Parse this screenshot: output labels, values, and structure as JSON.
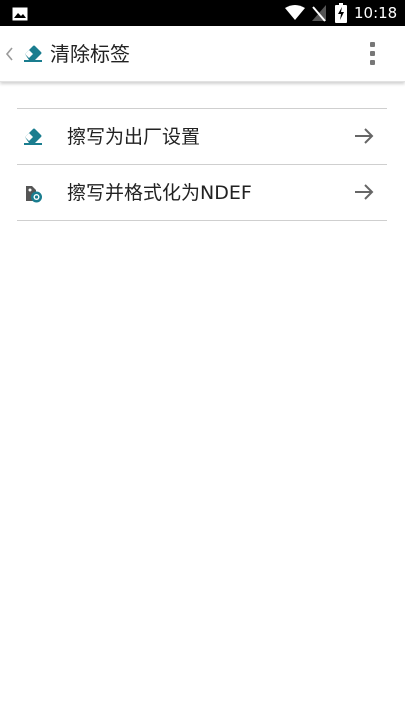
{
  "status_bar": {
    "time": "10:18",
    "icons": [
      "image-icon",
      "wifi-icon",
      "no-signal-icon",
      "battery-charging-icon"
    ]
  },
  "app_bar": {
    "title": "清除标签",
    "icon": "eraser-icon",
    "back_icon": "chevron-left-icon",
    "menu_icon": "overflow-menu-icon"
  },
  "list": {
    "items": [
      {
        "label": "擦写为出厂设置",
        "icon": "eraser-icon"
      },
      {
        "label": "擦写并格式化为NDEF",
        "icon": "tag-format-icon"
      }
    ],
    "arrow_icon": "arrow-right-icon"
  },
  "colors": {
    "accent": "#1a7d8f",
    "status_bar": "#000000",
    "text": "#222222",
    "divider": "#cfcfcf"
  }
}
